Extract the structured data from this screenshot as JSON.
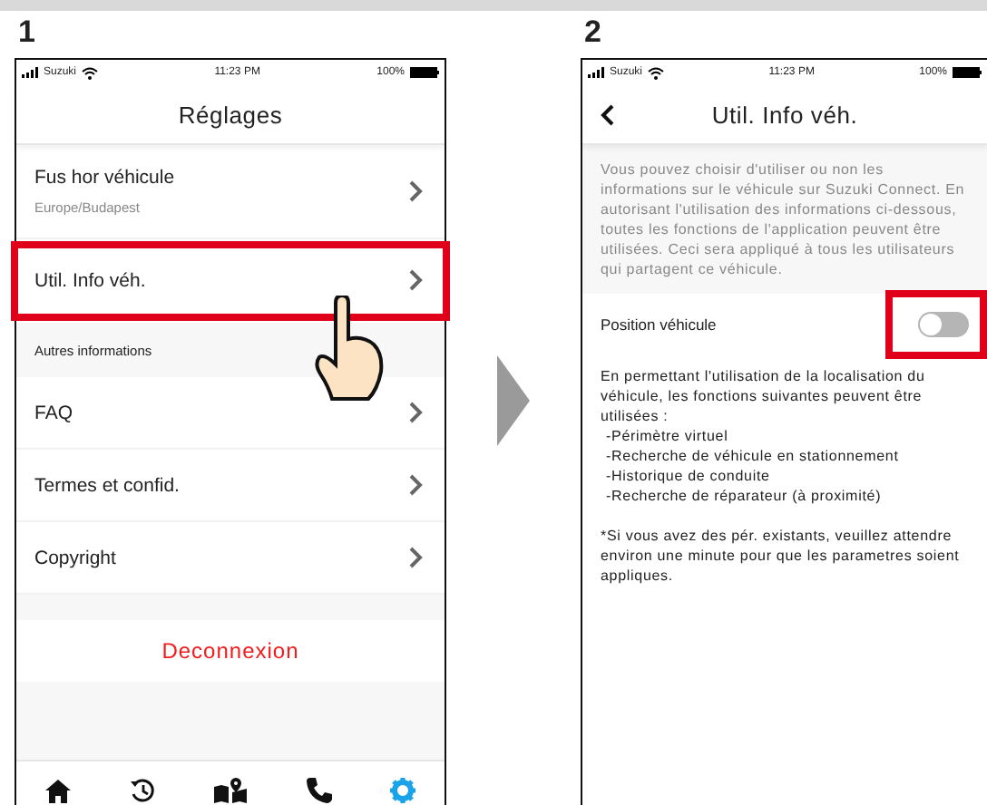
{
  "steps": [
    {
      "number": "1"
    },
    {
      "number": "2"
    }
  ],
  "settings_screen": {
    "status_bar": {
      "carrier": "Suzuki",
      "time": "11:23 PM",
      "battery": "100%"
    },
    "title": "Réglages",
    "items": [
      {
        "kind": "item",
        "label": "Fus hor véhicule",
        "sublabel": "Europe/Budapest",
        "highlighted": false
      },
      {
        "kind": "item",
        "label": "Util. Info véh.",
        "highlighted": true
      },
      {
        "kind": "section",
        "label": "Autres informations"
      },
      {
        "kind": "item",
        "label": "FAQ",
        "highlighted": false
      },
      {
        "kind": "item",
        "label": "Termes et confid.",
        "highlighted": false
      },
      {
        "kind": "item",
        "label": "Copyright",
        "highlighted": false
      }
    ],
    "logout": "Deconnexion",
    "tab_bar": [
      {
        "kind": "home",
        "selected": false
      },
      {
        "kind": "history",
        "selected": false
      },
      {
        "kind": "map",
        "selected": false
      },
      {
        "kind": "phone",
        "selected": false
      },
      {
        "kind": "settings",
        "selected": true
      }
    ]
  },
  "vehicle_info_screen": {
    "status_bar": {
      "carrier": "Suzuki",
      "time": "11:23 PM",
      "battery": "100%"
    },
    "title": "Util. Info véh.",
    "intro": "Vous pouvez choisir d'utiliser ou non les informations sur le véhicule sur Suzuki Connect. En autorisant l'utilisation des informations ci-dessous, toutes les fonctions de l'application peuvent être utilisées. Ceci sera appliqué à tous les utilisateurs qui partagent ce véhicule.",
    "toggle": {
      "label": "Position véhicule",
      "on": false,
      "highlighted": true
    },
    "description": "En permettant l'utilisation de la localisation du véhicule, les fonctions suivantes peuvent être utilisées :",
    "features": [
      "-Périmètre virtuel",
      "-Recherche de véhicule en stationnement",
      "-Historique de conduite",
      "-Recherche de réparateur (à proximité)"
    ],
    "note": "*Si vous avez des pér. existants, veuillez attendre environ une minute pour que les parametres soient appliques."
  }
}
